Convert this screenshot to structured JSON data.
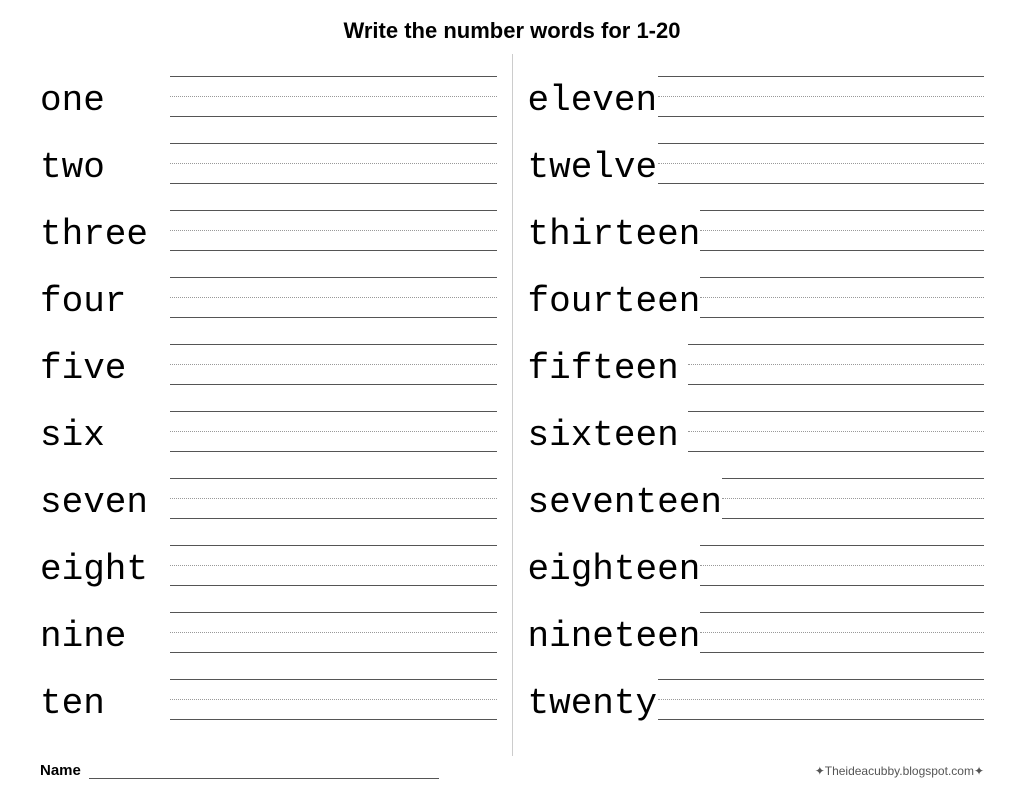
{
  "title": "Write the number words for  1-20",
  "left_column": [
    {
      "word": "one"
    },
    {
      "word": "two"
    },
    {
      "word": "three"
    },
    {
      "word": "four"
    },
    {
      "word": "five"
    },
    {
      "word": "six"
    },
    {
      "word": "seven"
    },
    {
      "word": "eight"
    },
    {
      "word": "nine"
    },
    {
      "word": "ten"
    }
  ],
  "right_column": [
    {
      "word": "eleven"
    },
    {
      "word": "twelve"
    },
    {
      "word": "thirteen"
    },
    {
      "word": "fourteen"
    },
    {
      "word": "fifteen"
    },
    {
      "word": "sixteen"
    },
    {
      "word": "seventeen"
    },
    {
      "word": "eighteen"
    },
    {
      "word": "nineteen"
    },
    {
      "word": "twenty"
    }
  ],
  "footer": {
    "name_label": "Name",
    "website": "✦Theideacubby.blogspot.com✦"
  }
}
